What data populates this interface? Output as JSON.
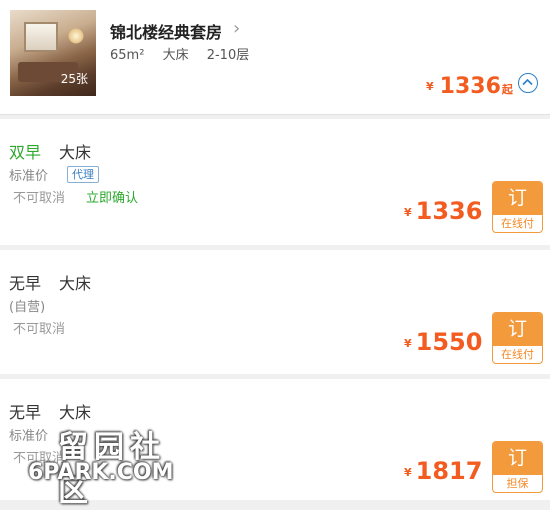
{
  "room": {
    "title": "锦北楼经典套房",
    "photo_count": "25张",
    "area": "65m²",
    "bed": "大床",
    "floor": "2-10层",
    "price_currency": "¥",
    "price": "1336",
    "price_suffix": "起"
  },
  "rates": [
    {
      "breakfast": "双早",
      "bed": "大床",
      "price_type": "标准价",
      "tag": "代理",
      "cancel": "不可取消",
      "confirm": "立即确认",
      "currency": "¥",
      "price": "1336",
      "book_label": "订",
      "pay_label": "在线付"
    },
    {
      "breakfast": "无早",
      "bed": "大床",
      "price_type": "(自营)",
      "cancel": "不可取消",
      "currency": "¥",
      "price": "1550",
      "book_label": "订",
      "pay_label": "在线付"
    },
    {
      "breakfast": "无早",
      "bed": "大床",
      "price_type": "标准价",
      "cancel": "不可取消",
      "currency": "¥",
      "price": "1817",
      "book_label": "订",
      "pay_label": "担保"
    }
  ],
  "watermark": {
    "cn": "留园社区",
    "en": "6PARK.COM"
  },
  "colors": {
    "price": "#f35c21",
    "book_button": "#f39a3c",
    "breakfast_green": "#2ea82e",
    "link_blue": "#2b80c7"
  }
}
